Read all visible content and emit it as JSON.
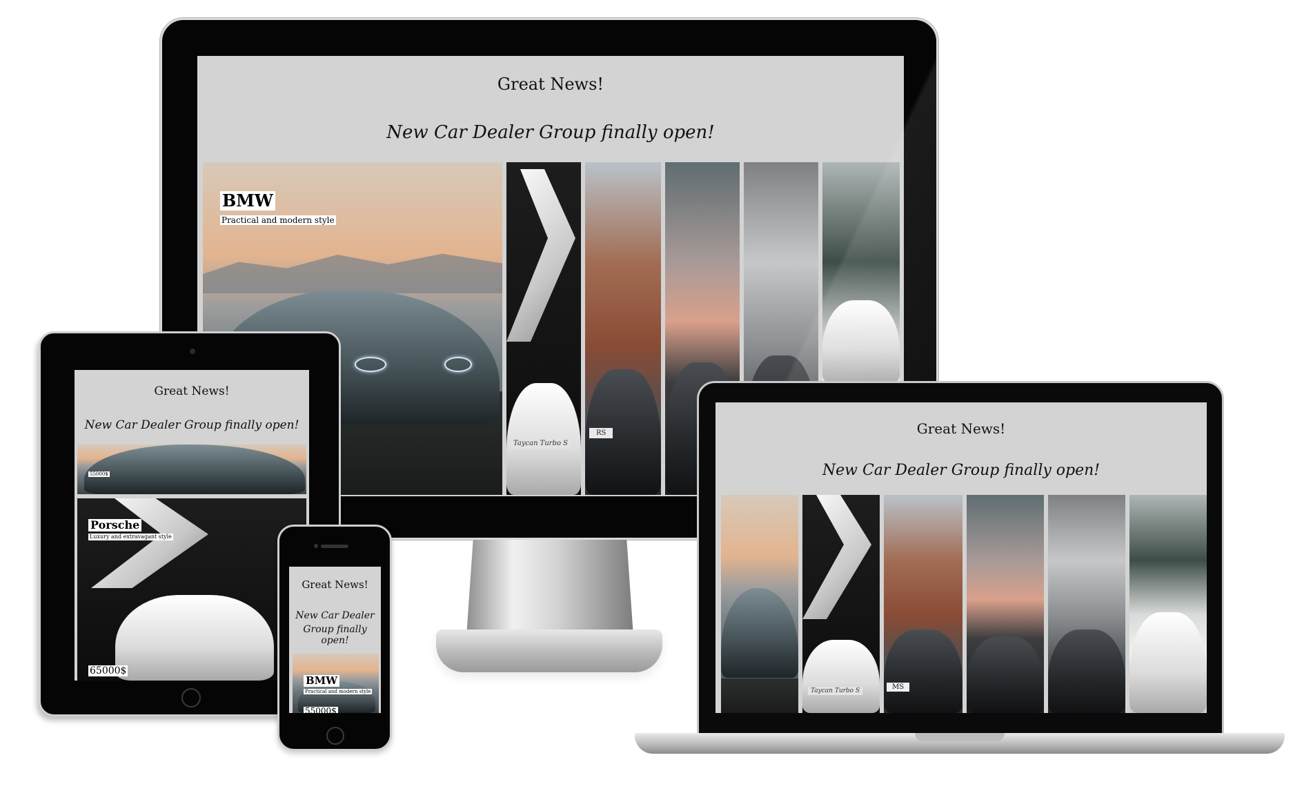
{
  "site": {
    "title": "Great News!",
    "subtitle": "New Car Dealer Group finally open!",
    "subtitle_phone_line1": "New Car Dealer",
    "subtitle_phone_line2": "Group finally open!"
  },
  "cars": [
    {
      "name": "BMW",
      "description": "Practical and modern style",
      "price": "55000$"
    },
    {
      "name": "Porsche",
      "description": "Luxury and extravagant style",
      "price": "65000$"
    }
  ],
  "badges": {
    "porsche_script": "Taycan Turbo S",
    "ford_plate": "RS",
    "ms_plate": "MS"
  }
}
